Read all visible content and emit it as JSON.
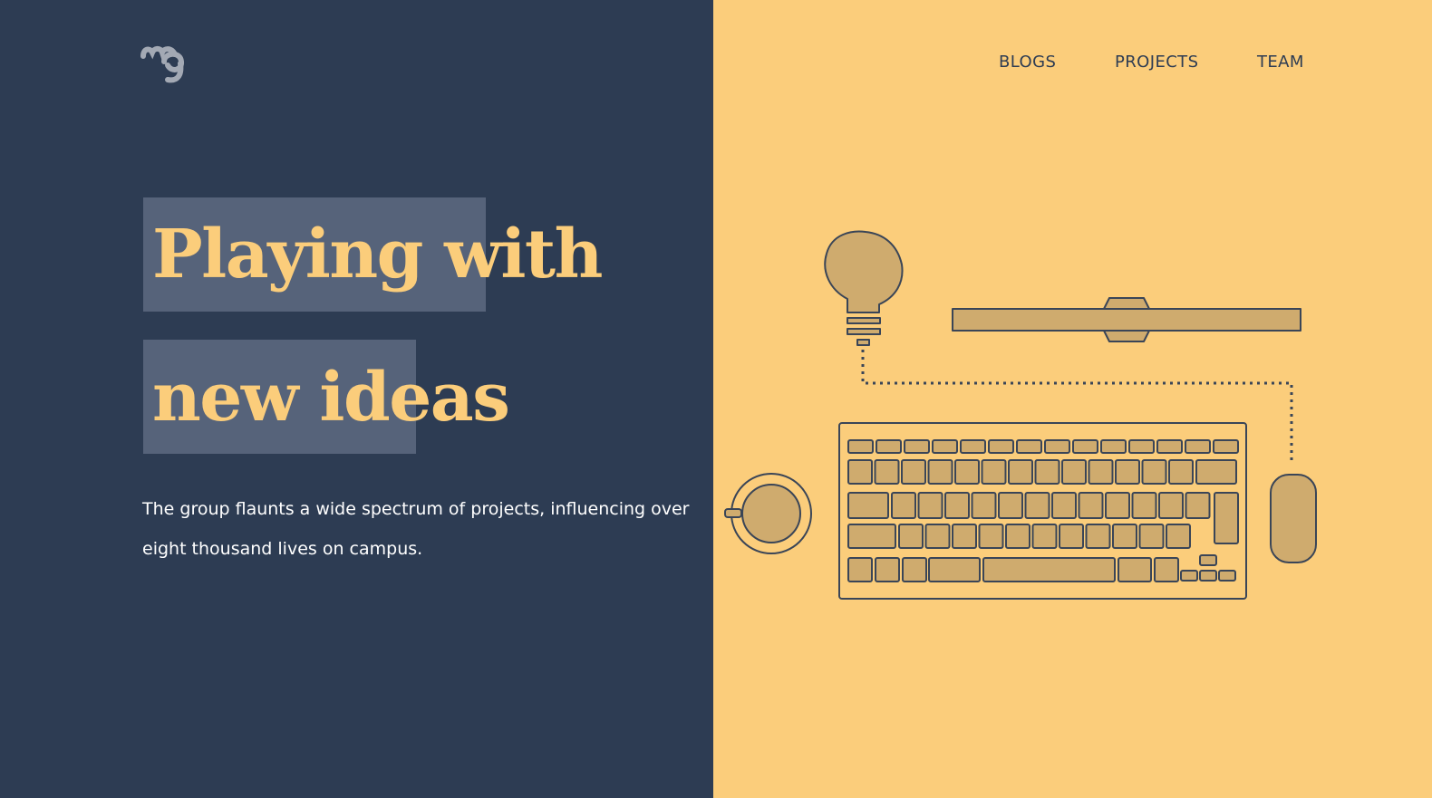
{
  "header": {
    "logo": "mg-logo",
    "nav": [
      {
        "label": "BLOGS"
      },
      {
        "label": "PROJECTS"
      },
      {
        "label": "TEAM"
      }
    ]
  },
  "hero": {
    "headline_line1": "Playing with",
    "headline_line2": "new ideas",
    "description": "The group flaunts a wide spectrum of projects, influencing over eight thousand lives on campus."
  },
  "illustration": {
    "items": [
      "lightbulb-icon",
      "monitor-stand-icon",
      "keyboard-icon",
      "coffee-cup-icon",
      "mouse-icon"
    ]
  },
  "colors": {
    "left_panel": "#2d3c53",
    "right_panel": "#fbcd7b",
    "highlight": "#56637a",
    "accent": "#fbcd7b",
    "object_fill": "#cfab6e",
    "outline": "#3a4557"
  }
}
